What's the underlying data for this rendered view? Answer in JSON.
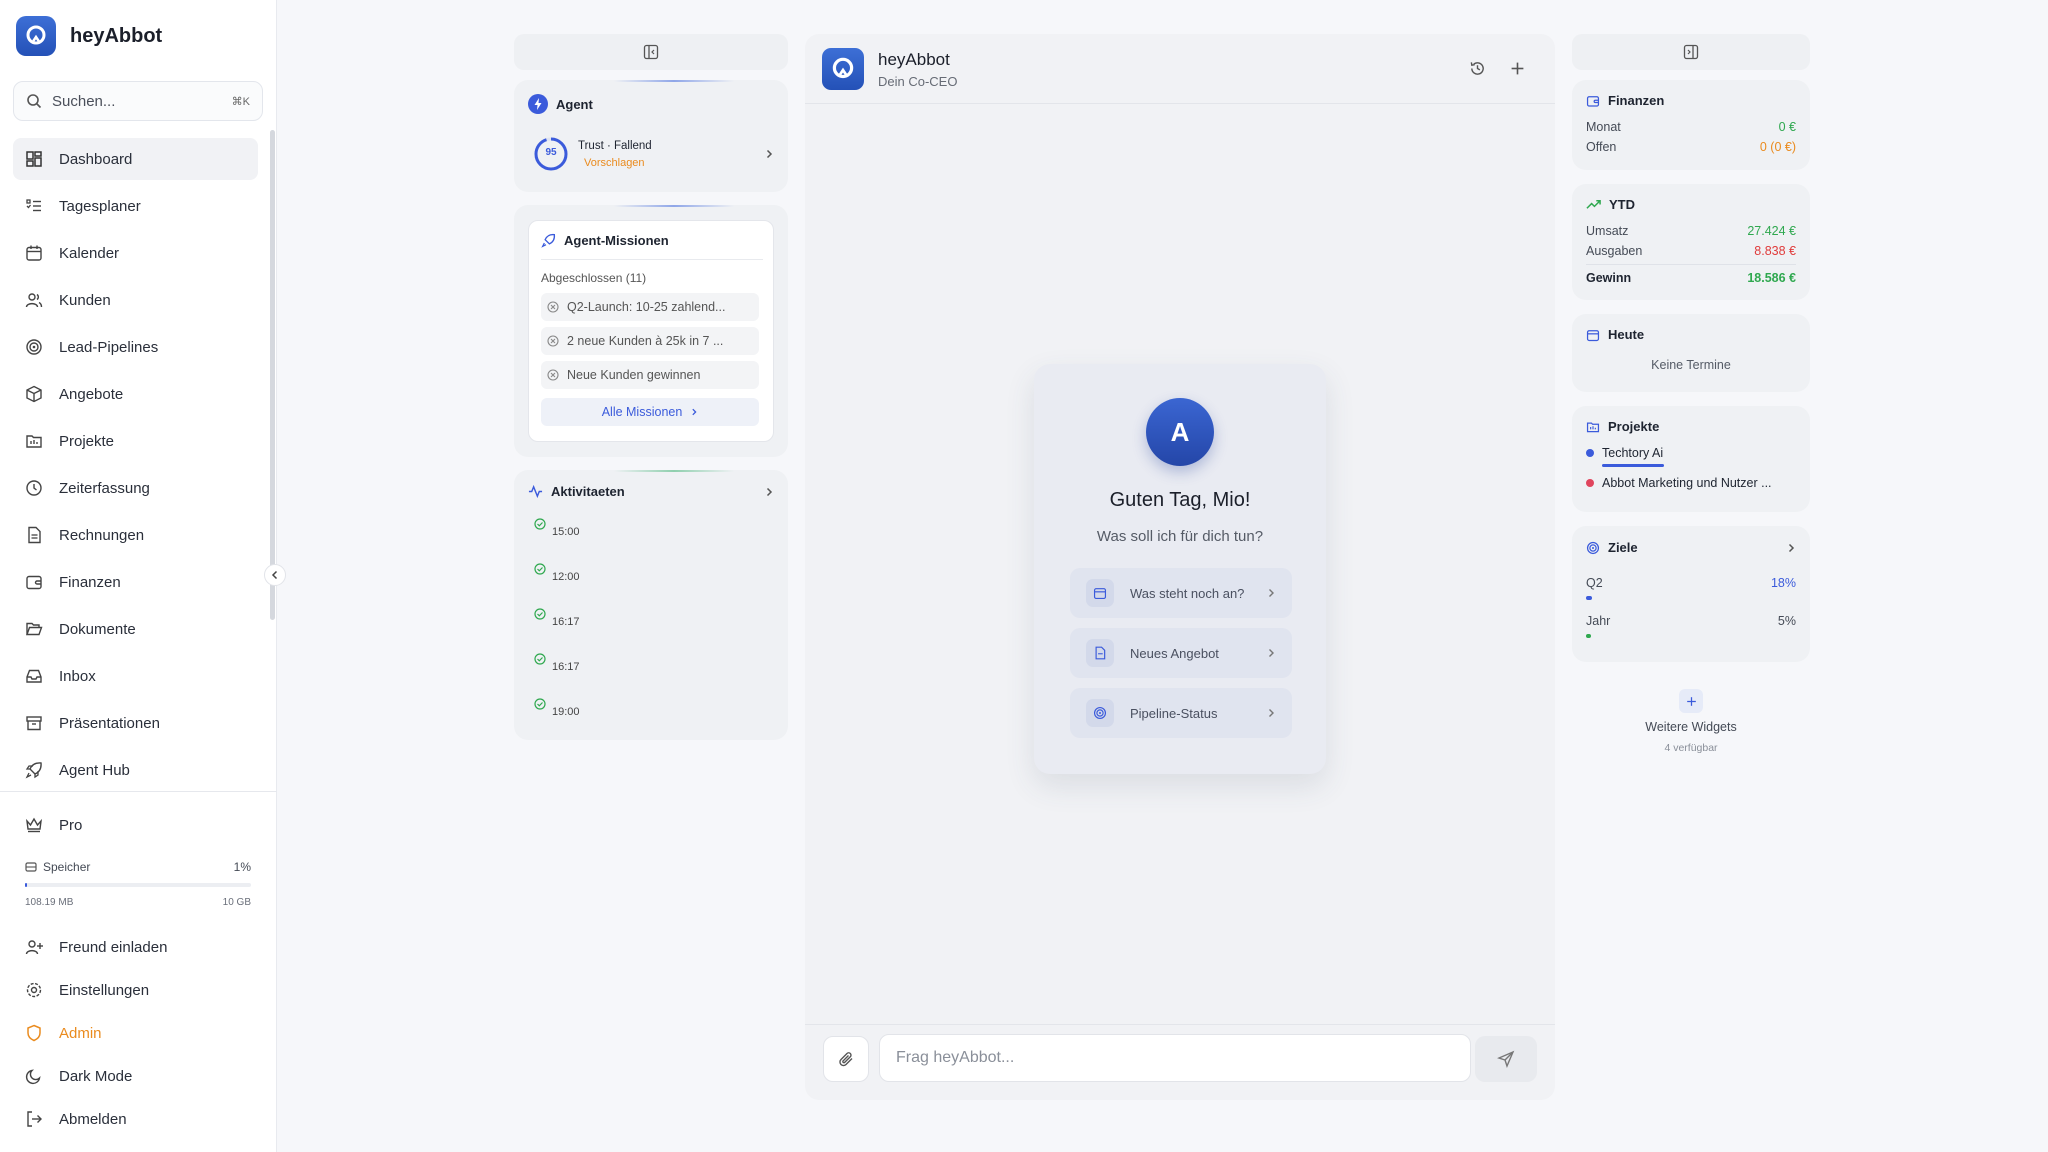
{
  "app": {
    "name": "heyAbbot"
  },
  "search": {
    "placeholder": "Suchen...",
    "shortcut": "⌘K"
  },
  "sidebar": {
    "items": [
      {
        "label": "Dashboard",
        "icon": "dashboard-icon",
        "active": true
      },
      {
        "label": "Tagesplaner",
        "icon": "list-check-icon"
      },
      {
        "label": "Kalender",
        "icon": "calendar-icon"
      },
      {
        "label": "Kunden",
        "icon": "users-icon"
      },
      {
        "label": "Lead-Pipelines",
        "icon": "target-icon"
      },
      {
        "label": "Angebote",
        "icon": "package-icon"
      },
      {
        "label": "Projekte",
        "icon": "folder-chart-icon"
      },
      {
        "label": "Zeiterfassung",
        "icon": "clock-icon"
      },
      {
        "label": "Rechnungen",
        "icon": "file-text-icon"
      },
      {
        "label": "Finanzen",
        "icon": "wallet-icon"
      },
      {
        "label": "Dokumente",
        "icon": "folder-open-icon"
      },
      {
        "label": "Inbox",
        "icon": "inbox-icon"
      },
      {
        "label": "Präsentationen",
        "icon": "archive-icon"
      },
      {
        "label": "Agent Hub",
        "icon": "rocket-icon"
      }
    ],
    "pro_label": "Pro",
    "storage": {
      "label": "Speicher",
      "percent_label": "1%",
      "used": "108.19 MB",
      "total": "10 GB",
      "fraction": 0.01
    },
    "bottom_items": [
      {
        "label": "Freund einladen",
        "icon": "user-plus-icon"
      },
      {
        "label": "Einstellungen",
        "icon": "settings-icon"
      },
      {
        "label": "Admin",
        "icon": "shield-icon"
      },
      {
        "label": "Dark Mode",
        "icon": "moon-icon"
      },
      {
        "label": "Abmelden",
        "icon": "logout-icon"
      }
    ]
  },
  "agent": {
    "title": "Agent",
    "trust_score": "95",
    "trust_label": "Trust · Fallend",
    "suggest_label": "Vorschlagen"
  },
  "missions": {
    "title": "Agent-Missionen",
    "done_label": "Abgeschlossen (11)",
    "items": [
      "Q2-Launch: 10-25 zahlend...",
      "2 neue Kunden à 25k in 7 ...",
      "Neue Kunden gewinnen"
    ],
    "all_label": "Alle Missionen"
  },
  "activities": {
    "title": "Aktivitaeten",
    "times": [
      "15:00",
      "12:00",
      "16:17",
      "16:17",
      "19:00"
    ]
  },
  "chat": {
    "title": "heyAbbot",
    "subtitle": "Dein Co-CEO",
    "avatar_letter": "A",
    "greeting": "Guten Tag, Mio!",
    "question": "Was soll ich für dich tun?",
    "quick_actions": [
      "Was steht noch an?",
      "Neues Angebot",
      "Pipeline-Status"
    ],
    "input_placeholder": "Frag heyAbbot..."
  },
  "widgets": {
    "finanzen": {
      "title": "Finanzen",
      "rows": [
        {
          "label": "Monat",
          "value": "0 €"
        },
        {
          "label": "Offen",
          "value": "0 (0 €)"
        }
      ]
    },
    "ytd": {
      "title": "YTD",
      "umsatz_label": "Umsatz",
      "umsatz": "27.424 €",
      "ausgaben_label": "Ausgaben",
      "ausgaben": "8.838 €",
      "gewinn_label": "Gewinn",
      "gewinn": "18.586 €"
    },
    "heute": {
      "title": "Heute",
      "empty": "Keine Termine"
    },
    "projekte": {
      "title": "Projekte",
      "items": [
        "Techtory Ai",
        "Abbot Marketing und Nutzer ..."
      ]
    },
    "ziele": {
      "title": "Ziele",
      "q2_label": "Q2",
      "q2_value": "18%",
      "q2_fraction": 0.18,
      "jahr_label": "Jahr",
      "jahr_value": "5%",
      "jahr_fraction": 0.05
    },
    "more": {
      "label": "Weitere Widgets",
      "sub": "4 verfügbar"
    }
  },
  "colors": {
    "accent": "#3b5bdb",
    "positive": "#2fa84f",
    "negative": "#e03b3b",
    "warning": "#ea8b1e"
  }
}
